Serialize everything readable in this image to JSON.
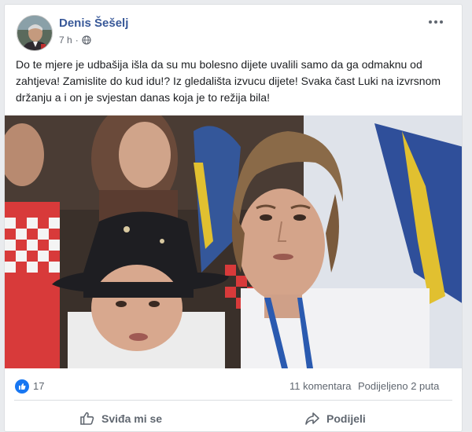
{
  "post": {
    "author": "Denis Šešelj",
    "time": "7 h",
    "separator": "·",
    "text": "Do te mjere je udbašija išla da su mu bolesno dijete uvalili samo da ga odmaknu od zahtjeva! Zamislite do kud idu!? Iz gledališta izvucu dijete! Svaka čast Luki na izvrsnom držanju a i on je svjestan danas koja je to režija bila!"
  },
  "stats": {
    "likes": "17",
    "comments": "11 komentara",
    "shares": "Podijeljeno 2 puta"
  },
  "actions": {
    "like_label": "Sviđa mi se",
    "share_label": "Podijeli"
  },
  "icons": {
    "menu": "more-options-icon",
    "audience": "globe-icon",
    "like": "thumbs-up-icon",
    "share": "share-arrow-icon"
  },
  "colors": {
    "author": "#385898",
    "like_blue": "#1877f2",
    "muted": "#606770"
  }
}
